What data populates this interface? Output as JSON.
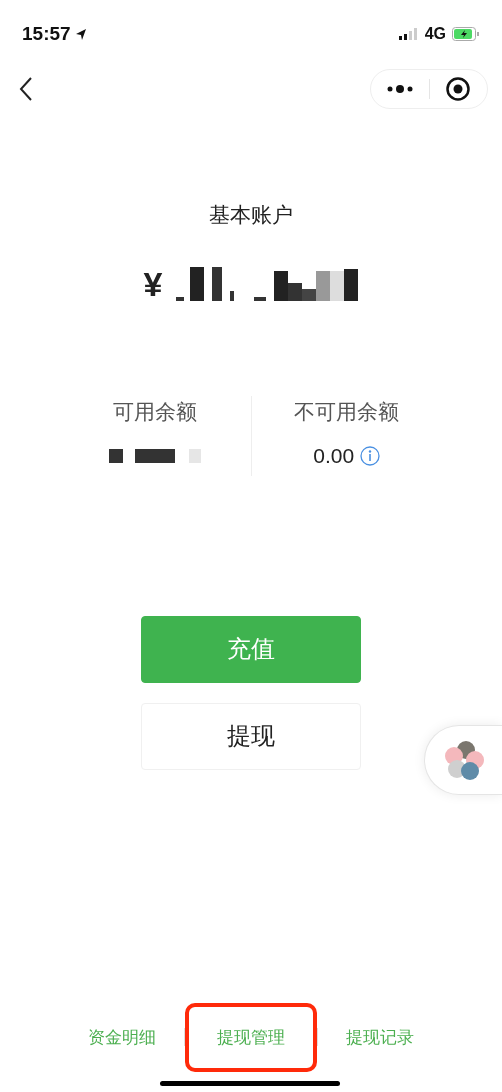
{
  "status_bar": {
    "time": "15:57",
    "network": "4G"
  },
  "account": {
    "title": "基本账户",
    "currency": "¥"
  },
  "balances": [
    {
      "label": "可用余额",
      "value_redacted": true,
      "info": false
    },
    {
      "label": "不可用余额",
      "value": "0.00",
      "value_redacted": false,
      "info": true
    }
  ],
  "buttons": [
    {
      "label": "充值",
      "kind": "primary"
    },
    {
      "label": "提现",
      "kind": "secondary"
    }
  ],
  "bottom_links": [
    {
      "label": "资金明细",
      "highlighted": false
    },
    {
      "label": "提现管理",
      "highlighted": true
    },
    {
      "label": "提现记录",
      "highlighted": false
    }
  ]
}
